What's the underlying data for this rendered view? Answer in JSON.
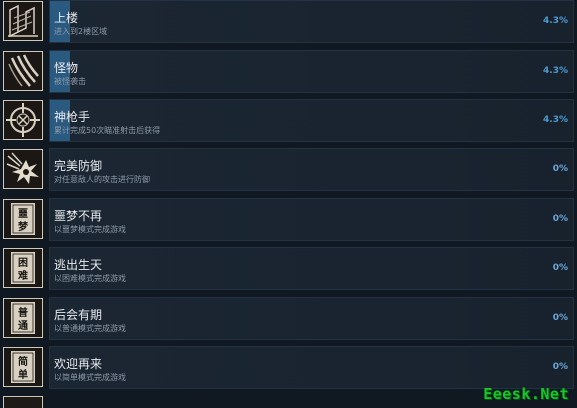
{
  "achievements": [
    {
      "title": "上楼",
      "desc": "进入到2楼区域",
      "pct": "4.3%",
      "fraction": 0.043,
      "icon": "stairs-icon",
      "badge": ""
    },
    {
      "title": "怪物",
      "desc": "被怪袭击",
      "pct": "4.3%",
      "fraction": 0.043,
      "icon": "claw-scratch-icon",
      "badge": ""
    },
    {
      "title": "神枪手",
      "desc": "累计完成50次瞄准射击后获得",
      "pct": "4.3%",
      "fraction": 0.043,
      "icon": "crosshair-icon",
      "badge": ""
    },
    {
      "title": "完美防御",
      "desc": "对任意敌人的攻击进行防御",
      "pct": "0%",
      "fraction": 0,
      "icon": "impact-burst-icon",
      "badge": ""
    },
    {
      "title": "噩梦不再",
      "desc": "以噩梦模式完成游戏",
      "pct": "0%",
      "fraction": 0,
      "icon": "nightmare-badge-icon",
      "badge": "噩梦"
    },
    {
      "title": "逃出生天",
      "desc": "以困难模式完成游戏",
      "pct": "0%",
      "fraction": 0,
      "icon": "hard-badge-icon",
      "badge": "困难"
    },
    {
      "title": "后会有期",
      "desc": "以普通模式完成游戏",
      "pct": "0%",
      "fraction": 0,
      "icon": "normal-badge-icon",
      "badge": "普通"
    },
    {
      "title": "欢迎再来",
      "desc": "以简单模式完成游戏",
      "pct": "0%",
      "fraction": 0,
      "icon": "easy-badge-icon",
      "badge": "简单"
    }
  ],
  "watermark": "Eeesk.Net",
  "colors": {
    "accent": "#2b5a80",
    "percent": "#4d9ad0",
    "watermark": "#16c62a"
  }
}
